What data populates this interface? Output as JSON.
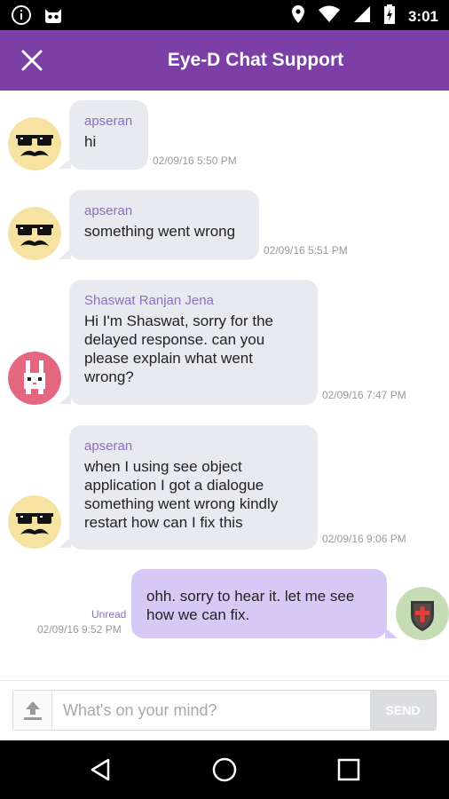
{
  "status_bar": {
    "time": "3:01",
    "icons": [
      "info-icon",
      "android-debug-icon",
      "location-icon",
      "wifi-icon",
      "signal-icon",
      "battery-charging-icon"
    ]
  },
  "app_bar": {
    "title": "Eye-D Chat Support",
    "close_icon": "close-icon"
  },
  "messages": [
    {
      "direction": "incoming",
      "sender": "apseran",
      "avatar": "sunglasses-mustache-avatar",
      "text": "hi",
      "time": "02/09/16 5:50 PM"
    },
    {
      "direction": "incoming",
      "sender": "apseran",
      "avatar": "sunglasses-mustache-avatar",
      "text": "something went wrong",
      "time": "02/09/16 5:51 PM"
    },
    {
      "direction": "incoming",
      "sender": "Shaswat Ranjan Jena",
      "avatar": "pixel-bunny-avatar",
      "text_lines": [
        "Hi I'm Shaswat, sorry for the",
        "delayed response. can you",
        "please explain what went",
        "wrong?"
      ],
      "time": "02/09/16 7:47 PM"
    },
    {
      "direction": "incoming",
      "sender": "apseran",
      "avatar": "sunglasses-mustache-avatar",
      "text_lines": [
        "when I using see object",
        "application I got a dialogue",
        "something went wrong kindly",
        "restart how can I fix this"
      ],
      "time": "02/09/16 9:06 PM"
    },
    {
      "direction": "outgoing",
      "status": "Unread",
      "avatar": "shield-cross-avatar",
      "text_lines": [
        "ohh. sorry to hear it. let me see",
        "how we can fix."
      ],
      "time": "02/09/16 9:52 PM"
    }
  ],
  "composer": {
    "placeholder": "What's on your mind?",
    "value": "",
    "send_label": "SEND",
    "upload_icon": "upload-icon"
  },
  "nav_bar": {
    "icons": [
      "back-icon",
      "home-icon",
      "recents-icon"
    ]
  },
  "colors": {
    "accent": "#7b3fa6",
    "incoming_bubble": "#e8eaef",
    "outgoing_bubble": "#d6c9f5",
    "sender_name": "#8a6fc0"
  }
}
